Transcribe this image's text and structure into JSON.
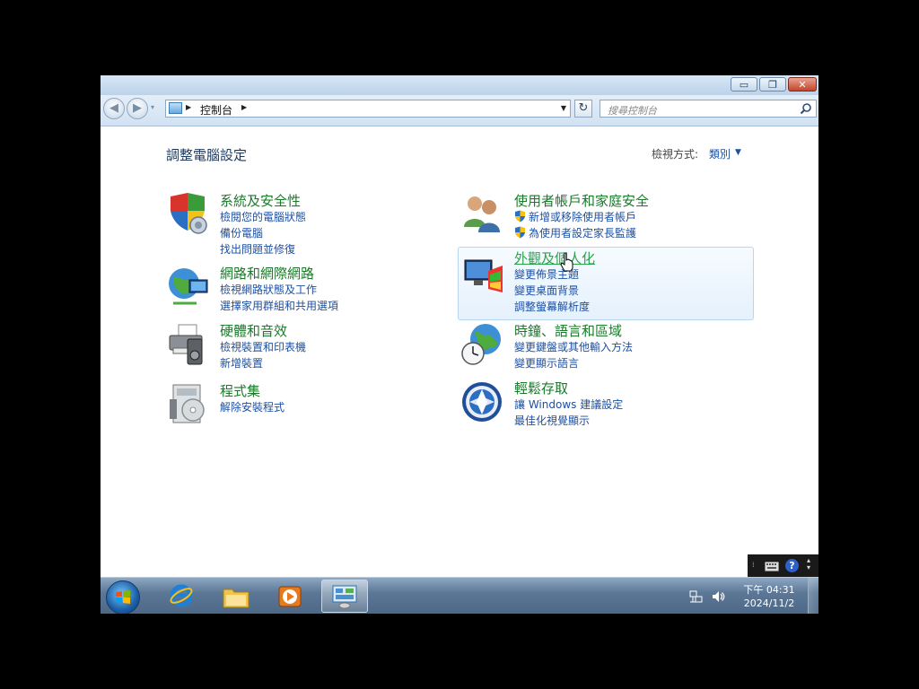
{
  "window": {
    "address_path": "控制台",
    "search_placeholder": "搜尋控制台",
    "controls": {
      "minimize": "▭",
      "maximize": "❐",
      "close": "✕"
    }
  },
  "header": {
    "title": "調整電腦設定",
    "view_by_label": "檢視方式:",
    "view_by_value": "類別"
  },
  "categories": [
    {
      "title": "系統及安全性",
      "links": [
        "檢閱您的電腦狀態",
        "備份電腦",
        "找出問題並修復"
      ],
      "icon": "shield-icon"
    },
    {
      "title": "網路和網際網路",
      "links": [
        "檢視網路狀態及工作",
        "選擇家用群組和共用選項"
      ],
      "icon": "network-globe-icon"
    },
    {
      "title": "硬體和音效",
      "links": [
        "檢視裝置和印表機",
        "新增裝置"
      ],
      "icon": "printer-icon"
    },
    {
      "title": "程式集",
      "links": [
        "解除安裝程式"
      ],
      "icon": "programs-icon"
    },
    {
      "title": "使用者帳戶和家庭安全",
      "links": [
        "新增或移除使用者帳戶",
        "為使用者設定家長監護"
      ],
      "icon": "users-icon"
    },
    {
      "title": "外觀及個人化",
      "links": [
        "變更佈景主題",
        "變更桌面背景",
        "調整螢幕解析度"
      ],
      "icon": "appearance-icon"
    },
    {
      "title": "時鐘、語言和區域",
      "links": [
        "變更鍵盤或其他輸入方法",
        "變更顯示語言"
      ],
      "icon": "clock-globe-icon"
    },
    {
      "title": "輕鬆存取",
      "links": [
        "讓 Windows 建議設定",
        "最佳化視覺顯示"
      ],
      "icon": "accessibility-icon"
    }
  ],
  "taskbar": {
    "pinned": [
      "internet-explorer-icon",
      "file-explorer-icon",
      "media-player-icon",
      "control-panel-icon"
    ],
    "clock_time": "下午 04:31",
    "clock_date": "2024/11/2"
  },
  "colors": {
    "link": "#1e50a2",
    "category_title": "#1a7a2a",
    "title": "#1e395b"
  }
}
